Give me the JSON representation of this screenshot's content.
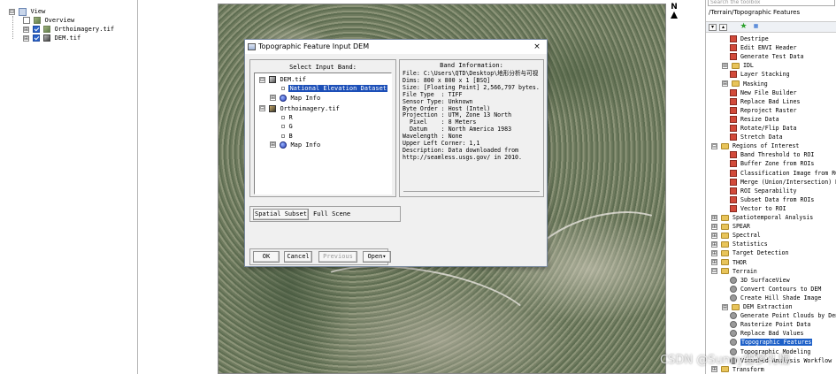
{
  "left_panel": {
    "items": [
      {
        "label": "View",
        "expander": "⊟",
        "checked": null,
        "icon": "view-icon"
      },
      {
        "label": "Overview",
        "expander": "",
        "checked": false,
        "icon": "layer-icon"
      },
      {
        "label": "Orthoimagery.tif",
        "expander": "⊞",
        "checked": true,
        "icon": "layer-icon"
      },
      {
        "label": "DEM.tif",
        "expander": "⊞",
        "checked": true,
        "icon": "dem-layer-icon"
      }
    ]
  },
  "north_arrow": {
    "label": "N"
  },
  "toolbox": {
    "search_placeholder": "Search the toolbox",
    "path": "/Terrain/Topographic Features",
    "items": [
      {
        "label": "Destripe",
        "type": "tool",
        "level": 2
      },
      {
        "label": "Edit ENVI Header",
        "type": "tool",
        "level": 2
      },
      {
        "label": "Generate Test Data",
        "type": "tool",
        "level": 2
      },
      {
        "label": "IDL",
        "type": "folder",
        "level": 2,
        "expander": "⊞"
      },
      {
        "label": "Layer Stacking",
        "type": "tool",
        "level": 2
      },
      {
        "label": "Masking",
        "type": "folder",
        "level": 2,
        "expander": "⊞"
      },
      {
        "label": "New File Builder",
        "type": "tool",
        "level": 2
      },
      {
        "label": "Replace Bad Lines",
        "type": "tool",
        "level": 2
      },
      {
        "label": "Reproject Raster",
        "type": "tool",
        "level": 2
      },
      {
        "label": "Resize Data",
        "type": "tool",
        "level": 2
      },
      {
        "label": "Rotate/Flip Data",
        "type": "tool",
        "level": 2
      },
      {
        "label": "Stretch Data",
        "type": "tool",
        "level": 2
      },
      {
        "label": "Regions of Interest",
        "type": "folder",
        "level": 1,
        "expander": "⊟"
      },
      {
        "label": "Band Threshold to ROI",
        "type": "tool",
        "level": 2
      },
      {
        "label": "Buffer Zone from ROIs",
        "type": "tool",
        "level": 2
      },
      {
        "label": "Classification Image from ROIs",
        "type": "tool",
        "level": 2
      },
      {
        "label": "Merge (Union/Intersection) ROIs",
        "type": "tool",
        "level": 2
      },
      {
        "label": "ROI Separability",
        "type": "tool",
        "level": 2
      },
      {
        "label": "Subset Data from ROIs",
        "type": "tool",
        "level": 2
      },
      {
        "label": "Vector to ROI",
        "type": "tool",
        "level": 2
      },
      {
        "label": "Spatiotemporal Analysis",
        "type": "folder",
        "level": 1,
        "expander": "⊞"
      },
      {
        "label": "SPEAR",
        "type": "folder",
        "level": 1,
        "expander": "⊞"
      },
      {
        "label": "Spectral",
        "type": "folder",
        "level": 1,
        "expander": "⊞"
      },
      {
        "label": "Statistics",
        "type": "folder",
        "level": 1,
        "expander": "⊞"
      },
      {
        "label": "Target Detection",
        "type": "folder",
        "level": 1,
        "expander": "⊞"
      },
      {
        "label": "THOR",
        "type": "folder",
        "level": 1,
        "expander": "⊞"
      },
      {
        "label": "Terrain",
        "type": "folder",
        "level": 1,
        "expander": "⊟"
      },
      {
        "label": "3D SurfaceView",
        "type": "gtool",
        "level": 2
      },
      {
        "label": "Convert Contours to DEM",
        "type": "gtool",
        "level": 2
      },
      {
        "label": "Create Hill Shade Image",
        "type": "gtool",
        "level": 2
      },
      {
        "label": "DEM Extraction",
        "type": "folder",
        "level": 2,
        "expander": "⊞"
      },
      {
        "label": "Generate Point Clouds by Dense Image Matching",
        "type": "gtool",
        "level": 2
      },
      {
        "label": "Rasterize Point Data",
        "type": "gtool",
        "level": 2
      },
      {
        "label": "Replace Bad Values",
        "type": "gtool",
        "level": 2
      },
      {
        "label": "Topographic Features",
        "type": "gtool",
        "level": 2,
        "selected": true
      },
      {
        "label": "Topographic Modeling",
        "type": "gtool",
        "level": 2
      },
      {
        "label": "Viewshed Analysis Workflow",
        "type": "gtool",
        "level": 2
      },
      {
        "label": "Transform",
        "type": "folder",
        "level": 1,
        "expander": "⊞"
      }
    ]
  },
  "dialog": {
    "title": "Topographic Feature Input DEM",
    "close_label": "×",
    "select_band_label": "Select Input Band:",
    "tree": [
      {
        "label": "DEM.tif",
        "expander": "⊟",
        "icon": "image-icon",
        "indent": 0
      },
      {
        "label": "National Elevation Dataset",
        "expander": "",
        "icon": "leaf-box",
        "indent": 1,
        "selected": true
      },
      {
        "label": "Map Info",
        "expander": "⊞",
        "icon": "globe-icon",
        "indent": 1
      },
      {
        "label": "Orthoimagery.tif",
        "expander": "⊟",
        "icon": "ortho-image-icon",
        "indent": 0
      },
      {
        "label": "R",
        "expander": "",
        "icon": "leaf-box",
        "indent": 1
      },
      {
        "label": "G",
        "expander": "",
        "icon": "leaf-box",
        "indent": 1
      },
      {
        "label": "B",
        "expander": "",
        "icon": "leaf-box",
        "indent": 1
      },
      {
        "label": "Map Info",
        "expander": "⊞",
        "icon": "globe-icon",
        "indent": 1
      }
    ],
    "band_info": {
      "heading": "Band Information:",
      "lines": [
        "File: C:\\Users\\QTD\\Desktop\\地形分析与可视",
        "Dims: 800 x 800 x 1 [BSQ]",
        "Size: [Floating Point] 2,566,797 bytes.",
        "File Type  : TIFF",
        "Sensor Type: Unknown",
        "Byte Order : Host (Intel)",
        "Projection : UTM, Zone 13 North",
        "  Pixel    : 8 Meters",
        "  Datum    : North America 1983",
        "Wavelength : None",
        "Upper Left Corner: 1,1",
        "Description: Data downloaded from",
        "http://seamless.usgs.gov/ in 2010."
      ]
    },
    "spatial_subset_label": "Spatial Subset",
    "spatial_subset_value": "Full Scene",
    "buttons": {
      "ok": "OK",
      "cancel": "Cancel",
      "previous": "Previous",
      "open": "Open▾"
    }
  },
  "watermark": "CSDN @Sunny雪梦礼糖"
}
